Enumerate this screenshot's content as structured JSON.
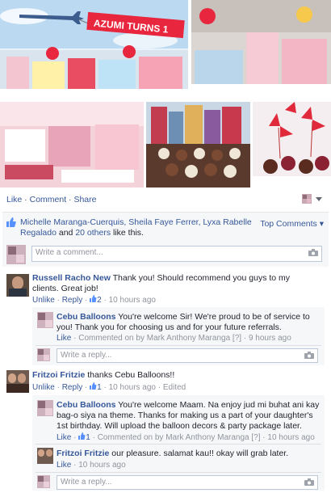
{
  "banner": {
    "text": "AZUMI TURNS 1"
  },
  "post_actions": {
    "like": "Like",
    "comment": "Comment",
    "share": "Share",
    "sep": " · "
  },
  "likes": {
    "names": "Michelle Maranga-Cuerquis, Sheila Faye Ferrer, Lyxa Rabelle Regalado",
    "and": " and ",
    "others": "20 others",
    "suffix": " like this.",
    "top_comments": "Top Comments ▾"
  },
  "main_input": {
    "placeholder": "Write a comment..."
  },
  "comments": [
    {
      "name": "Russell Racho New",
      "text": " Thank you! Should recommend you guys to my clients. Great job!",
      "unlike": "Unlike",
      "reply": "Reply",
      "likes": "2",
      "time": "10 hours ago",
      "replies": [
        {
          "name": "Cebu Balloons",
          "text": " You're welcome Sir! We're proud to be of service to you! Thank you for choosing us and for your future referrals.",
          "like": "Like",
          "commented_on": "Commented on by Mark Anthony Maranga",
          "flag": "[?]",
          "time": "9 hours ago"
        }
      ],
      "reply_placeholder": "Write a reply..."
    },
    {
      "name": "Fritzoi Fritzie",
      "text": " thanks Cebu Balloons!!",
      "unlike": "Unlike",
      "reply": "Reply",
      "likes": "1",
      "time": "10 hours ago",
      "edited": "Edited",
      "replies": [
        {
          "name": "Cebu Balloons",
          "text": " You're welcome Maam. Na enjoy jud mi buhat ani kay bag-o siya na theme. Thanks for making us a part of your daughter's 1st birthday. Will upload the balloon decors & party package later.",
          "like": "Like",
          "likes": "1",
          "commented_on": "Commented on by Mark Anthony Maranga",
          "flag": "[?]",
          "time": "10 hours ago"
        },
        {
          "name": "Fritzoi Fritzie",
          "text": " our pleasure. salamat kau!! okay will grab later.",
          "like": "Like",
          "time": "10 hours ago"
        }
      ],
      "reply_placeholder": "Write a reply..."
    }
  ],
  "colors": {
    "link": "#365899",
    "meta": "#90949c",
    "panel": "#f6f7f9"
  },
  "icons": [
    "thumbs-up-icon",
    "camera-icon",
    "share-selector-icon",
    "airplane-icon"
  ]
}
